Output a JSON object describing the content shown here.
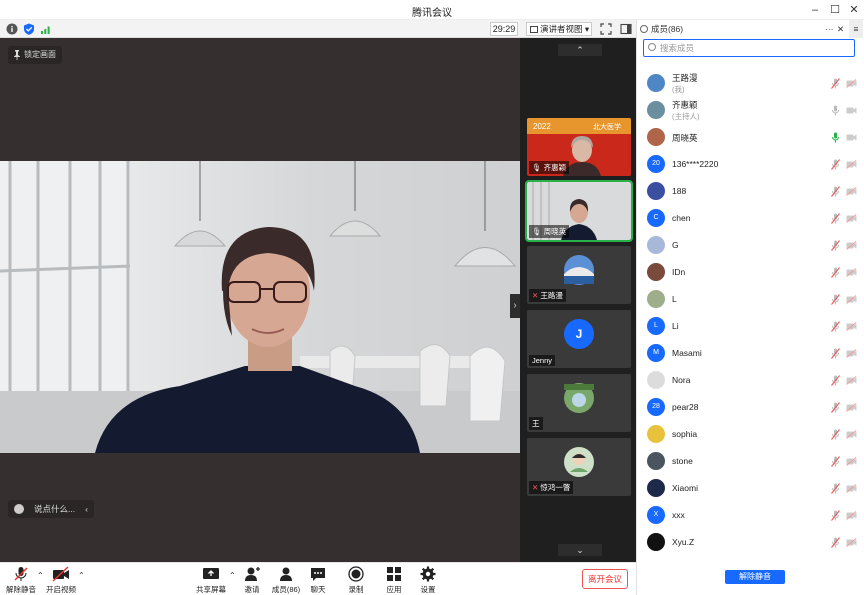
{
  "window": {
    "title": "腾讯会议"
  },
  "toolbar": {
    "timer": "29:29",
    "view_label": "演讲者视图"
  },
  "stage": {
    "lock_label": "锁定画面",
    "chat_placeholder": "说点什么..."
  },
  "tiles": [
    {
      "name": "齐惠颖",
      "banner": "2022",
      "banner_right": "北大医学"
    },
    {
      "name": "周晓英"
    },
    {
      "name": "王路漫"
    },
    {
      "name": "Jenny",
      "initial": "J"
    },
    {
      "name": "王"
    },
    {
      "name": "惊鸿一瞥"
    }
  ],
  "panel": {
    "title": "成员(86)",
    "search_placeholder": "搜索成员",
    "unmute_all": "解除静音",
    "accent": "#1769ff"
  },
  "members": [
    {
      "name": "王路漫",
      "sub": "(我)",
      "avatar": "photo-sky",
      "mic": "muted",
      "cam": "off"
    },
    {
      "name": "齐惠颖",
      "sub": "(主持人)",
      "avatar": "photo-lake",
      "mic": "on",
      "cam": "on"
    },
    {
      "name": "周晓英",
      "sub": "",
      "avatar": "photo-person",
      "mic": "speaking",
      "cam": "on"
    },
    {
      "name": "136****2220",
      "sub": "",
      "avatar": "20",
      "mic": "muted",
      "cam": "off"
    },
    {
      "name": "188",
      "sub": "",
      "avatar": "photo-flag",
      "mic": "muted",
      "cam": "off"
    },
    {
      "name": "chen",
      "sub": "",
      "avatar": "C",
      "mic": "muted",
      "cam": "off"
    },
    {
      "name": "G",
      "sub": "",
      "avatar": "photo-light",
      "mic": "muted",
      "cam": "off"
    },
    {
      "name": "IDn",
      "sub": "",
      "avatar": "photo-brown",
      "mic": "muted",
      "cam": "off"
    },
    {
      "name": "L",
      "sub": "",
      "avatar": "photo-field",
      "mic": "muted",
      "cam": "off"
    },
    {
      "name": "Li",
      "sub": "",
      "avatar": "L",
      "mic": "muted",
      "cam": "off"
    },
    {
      "name": "Masami",
      "sub": "",
      "avatar": "M",
      "mic": "muted",
      "cam": "off"
    },
    {
      "name": "Nora",
      "sub": "",
      "avatar": "photo-sketch",
      "mic": "muted",
      "cam": "off"
    },
    {
      "name": "pear28",
      "sub": "",
      "avatar": "28",
      "mic": "muted",
      "cam": "off"
    },
    {
      "name": "sophia",
      "sub": "",
      "avatar": "photo-minion",
      "mic": "muted",
      "cam": "off"
    },
    {
      "name": "stone",
      "sub": "",
      "avatar": "photo-dark",
      "mic": "muted",
      "cam": "off"
    },
    {
      "name": "Xiaomi",
      "sub": "",
      "avatar": "photo-night",
      "mic": "muted",
      "cam": "off"
    },
    {
      "name": "xxx",
      "sub": "",
      "avatar": "X",
      "mic": "muted",
      "cam": "off"
    },
    {
      "name": "Xyu.Z",
      "sub": "",
      "avatar": "photo-black",
      "mic": "muted",
      "cam": "off"
    }
  ],
  "bottom": {
    "unmute": "解除静音",
    "start_video": "开启视频",
    "share": "共享屏幕",
    "invite": "邀请",
    "members": "成员(86)",
    "chat": "聊天",
    "record": "录制",
    "apps": "应用",
    "settings": "设置",
    "leave": "离开会议"
  }
}
